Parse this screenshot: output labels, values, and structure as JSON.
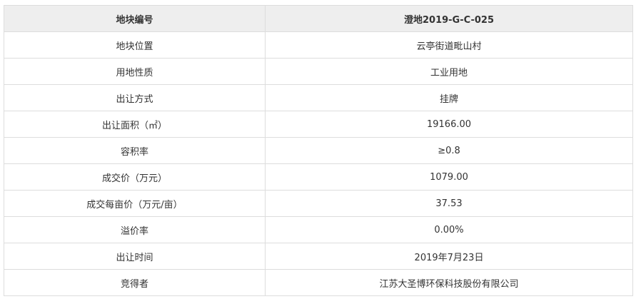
{
  "table": {
    "header": {
      "label": "地块编号",
      "value": "澄地2019-G-C-025"
    },
    "rows": [
      {
        "label": "地块位置",
        "value": "云亭街道毗山村"
      },
      {
        "label": "用地性质",
        "value": "工业用地"
      },
      {
        "label": "出让方式",
        "value": "挂牌"
      },
      {
        "label": "出让面积（㎡）",
        "value": "19166.00"
      },
      {
        "label": "容积率",
        "value": "≥0.8"
      },
      {
        "label": "成交价（万元）",
        "value": "1079.00"
      },
      {
        "label": "成交每亩价（万元/亩）",
        "value": "37.53"
      },
      {
        "label": "溢价率",
        "value": "0.00%"
      },
      {
        "label": "出让时间",
        "value": "2019年7月23日"
      },
      {
        "label": "竞得者",
        "value": "江苏大圣博环保科技股份有限公司"
      }
    ]
  }
}
